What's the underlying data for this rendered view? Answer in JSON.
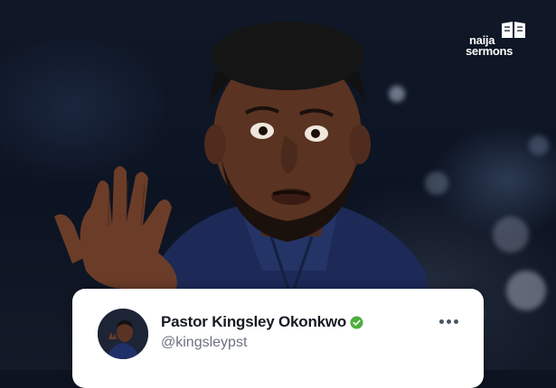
{
  "logo": {
    "line1": "naija",
    "line2": "sermons"
  },
  "post": {
    "author_name": "Pastor Kingsley Okonkwo",
    "handle": "@kingsleypst",
    "verified": true,
    "verified_color": "#4caf3c"
  },
  "icons": {
    "verified": "verified-check-icon",
    "more": "more-options-icon",
    "logo": "book-icon"
  }
}
